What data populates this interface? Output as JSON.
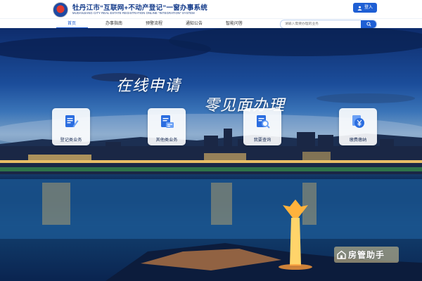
{
  "header": {
    "title": "牡丹江市“互联网+不动产登记”一窗办事系统",
    "subtitle": "MUDANJIANG CITY REAL ESTATE REGISTRATION ONLINE \"INTEGRATION\" SYSTEM",
    "login_label": "登入"
  },
  "nav": {
    "items": [
      {
        "label": "首页"
      },
      {
        "label": "办事指南"
      },
      {
        "label": "预警流程"
      },
      {
        "label": "通知公告"
      },
      {
        "label": "智能问答"
      }
    ],
    "search_placeholder": "请输入需要办理的业务"
  },
  "hero": {
    "slogan_line1": "在线申请",
    "slogan_line2": "零见面办理"
  },
  "services": [
    {
      "label": "登记类业务",
      "icon": "document-edit-icon"
    },
    {
      "label": "其他类业务",
      "icon": "document-card-icon"
    },
    {
      "label": "我要查询",
      "icon": "search-document-icon"
    },
    {
      "label": "缴费缴纳",
      "icon": "yen-payment-icon"
    }
  ],
  "watermark": {
    "text": "房管助手"
  },
  "colors": {
    "primary": "#1f5fd4",
    "title": "#123a8a",
    "icon_blue": "#2b6de0"
  }
}
